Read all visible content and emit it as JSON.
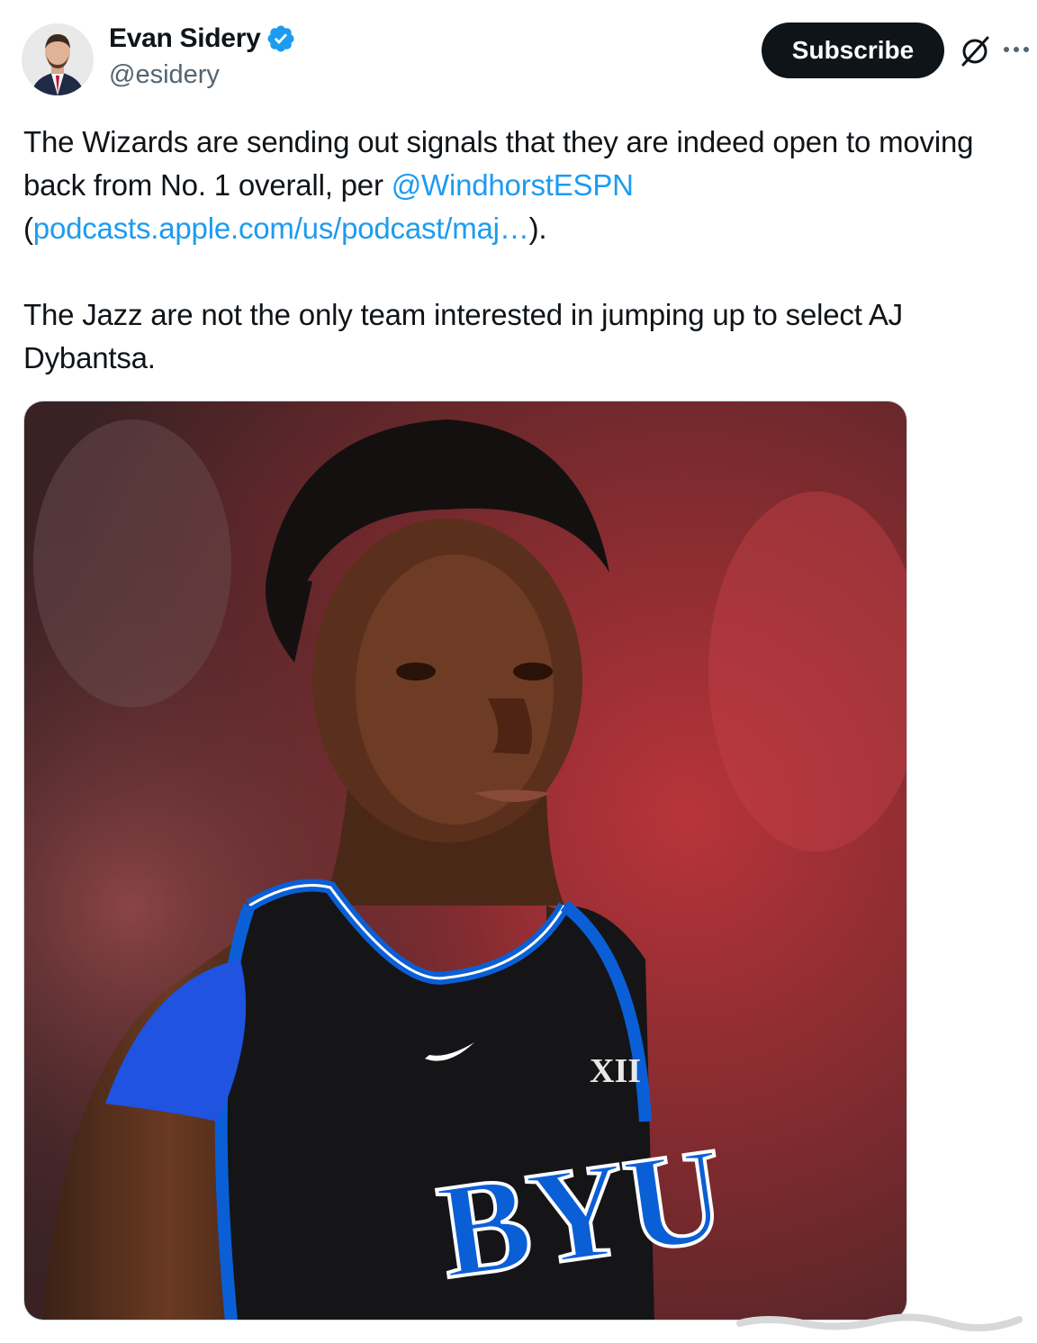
{
  "author": {
    "name": "Evan Sidery",
    "handle": "@esidery",
    "verified_icon": "verified-badge-icon",
    "avatar_icon": "avatar-photo"
  },
  "actions": {
    "subscribe_label": "Subscribe",
    "grok_icon": "grok-icon",
    "more_icon": "more-options-icon"
  },
  "tweet": {
    "line1_text": "The Wizards are sending out signals that they are indeed open to moving back from No. 1 overall, per ",
    "mention": "@WindhorstESPN",
    "link_open": "(",
    "link_text": "podcasts.apple.com/us/podcast/maj…",
    "link_close": ").",
    "paragraph2": "The Jazz are not the only team interested in jumping up to select AJ Dybantsa."
  },
  "media": {
    "description_icon": "player-photo",
    "jersey_text": "BYU",
    "conference_logo_text": "XII"
  },
  "colors": {
    "link": "#1d9bf0",
    "text": "#0f1419",
    "secondary": "#536471",
    "jersey_blue": "#0b5fd6"
  }
}
